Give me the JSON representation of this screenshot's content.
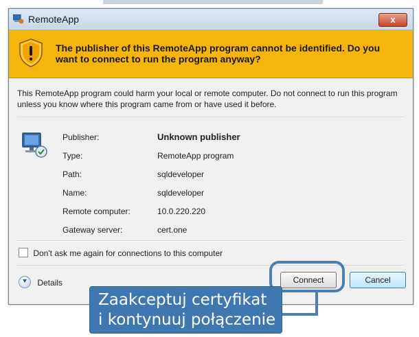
{
  "background_window": {
    "title_fragment": "..."
  },
  "window": {
    "title": "RemoteApp",
    "close_label": "x"
  },
  "warning": {
    "message": "The publisher of this RemoteApp program cannot be identified. Do you want to connect to run the program anyway?"
  },
  "description": "This RemoteApp program could harm your local or remote computer. Do not connect to run this program unless you know where this program came from or have used it before.",
  "details": [
    {
      "label": "Publisher:",
      "value": "Unknown publisher"
    },
    {
      "label": "Type:",
      "value": "RemoteApp program"
    },
    {
      "label": "Path:",
      "value": "sqldeveloper"
    },
    {
      "label": "Name:",
      "value": "sqldeveloper"
    },
    {
      "label": "Remote computer:",
      "value": "10.0.220.220"
    },
    {
      "label": "Gateway server:",
      "value": "cert.one"
    }
  ],
  "checkbox": {
    "label": "Don't ask me again for connections to this computer",
    "checked": false
  },
  "details_toggle": {
    "label": "Details"
  },
  "buttons": {
    "connect": "Connect",
    "cancel": "Cancel"
  },
  "callout": {
    "line1": "Zaakceptuj certyfikat",
    "line2": "i kontynuuj połączenie"
  },
  "colors": {
    "warning_banner": "#f5b50d",
    "callout": "#3f78b0",
    "titlebar": "#c7d6e8"
  },
  "icons": [
    "remoteapp-icon",
    "close-icon",
    "shield-warning-icon",
    "computer-icon",
    "details-chevron-icon"
  ]
}
